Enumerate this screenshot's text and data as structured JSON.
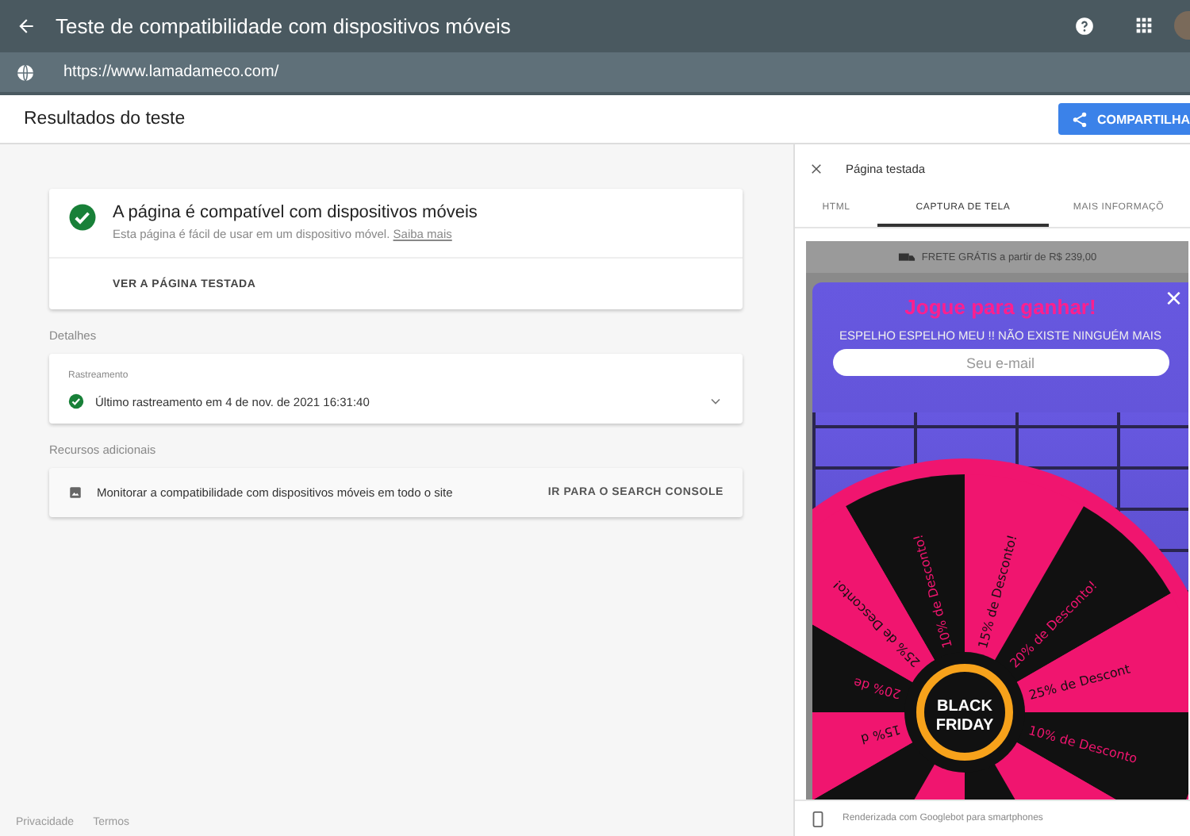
{
  "app_bar": {
    "title": "Teste de compatibilidade com dispositivos móveis",
    "url": "https://www.lamadameco.com/"
  },
  "results_bar": {
    "title": "Resultados do teste",
    "share_button": "COMPARTILHA"
  },
  "summary_card": {
    "title": "A página é compatível com dispositivos móveis",
    "description": "Esta página é fácil de usar em um dispositivo móvel. ",
    "link": "Saiba mais",
    "action": "VER A PÁGINA TESTADA"
  },
  "details": {
    "heading": "Detalhes",
    "label": "Rastreamento",
    "text": "Último rastreamento em 4 de nov. de 2021 16:31:40",
    "expanded": false
  },
  "resources": {
    "heading": "Recursos adicionais",
    "text": "Monitorar a compatibilidade com dispositivos móveis em todo o site",
    "action": "IR PARA O SEARCH CONSOLE"
  },
  "footer_links": [
    "Privacidade",
    "Termos"
  ],
  "preview": {
    "title": "Página testada",
    "tabs": [
      {
        "label": "HTML",
        "selected": false
      },
      {
        "label": "CAPTURA DE TELA",
        "selected": true
      },
      {
        "label": "MAIS INFORMAÇÕ",
        "selected": false
      }
    ],
    "screenshot": {
      "banner": "FRETE GRÁTIS a partir de R$ 239,00",
      "popup_title": "Jogue para ganhar!",
      "popup_subtitle": "ESPELHO ESPELHO MEU !! NÃO EXISTE NINGUÉM MAIS",
      "email_placeholder": "Seu e-mail",
      "close": "×",
      "wheel_segments": [
        {
          "label": "10% de Desconto!",
          "color": "#111111"
        },
        {
          "label": "15% de Desconto!",
          "color": "#f0156f"
        },
        {
          "label": "20% de Desconto!",
          "color": "#111111"
        },
        {
          "label": "25% de Descont",
          "color": "#f0156f"
        },
        {
          "label": "10% de Desconto",
          "color": "#111111"
        },
        {
          "color": "#f0156f"
        },
        {
          "color": "#111111"
        },
        {
          "color": "#f0156f"
        },
        {
          "color": "#111111"
        },
        {
          "label": "15% d",
          "color": "#f0156f"
        },
        {
          "label": "20% de",
          "color": "#111111"
        },
        {
          "label": "25% de Desconto!",
          "color": "#f0156f"
        }
      ],
      "badge_top": "BLACK",
      "badge_bottom": "FRIDAY"
    },
    "footer": "Renderizada com Googlebot para smartphones"
  }
}
